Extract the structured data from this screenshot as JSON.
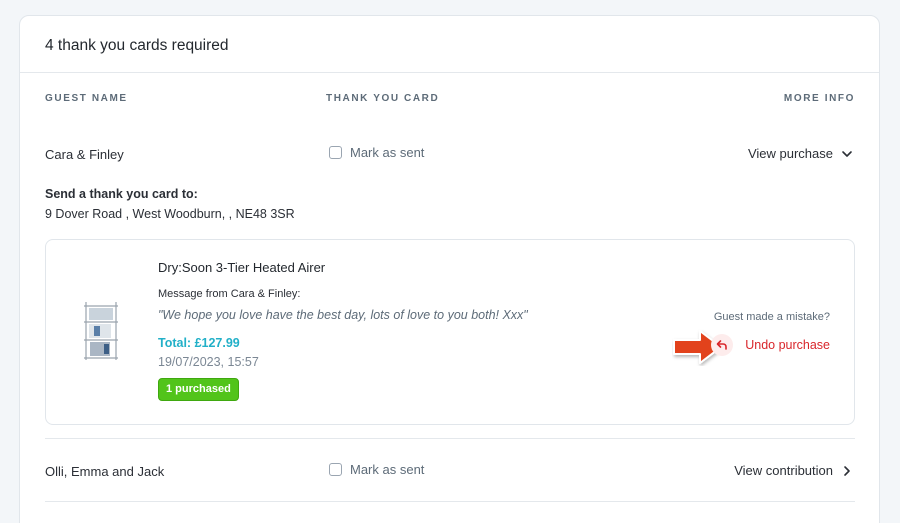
{
  "header": {
    "title": "4 thank you cards required"
  },
  "columns": {
    "guest_name": "GUEST NAME",
    "thank_you_card": "THANK YOU CARD",
    "more_info": "MORE INFO"
  },
  "rows": [
    {
      "guest": "Cara & Finley",
      "mark_label": "Mark as sent",
      "action_label": "View purchase",
      "send_to_label": "Send a thank you card to:",
      "address": "9 Dover Road , West Woodburn, , NE48 3SR",
      "purchase": {
        "product_name": "Dry:Soon 3-Tier Heated Airer",
        "message_label": "Message from Cara & Finley:",
        "message": "\"We hope you love have the best day, lots of love to you both! Xxx\"",
        "total": "Total: £127.99",
        "date": "19/07/2023, 15:57",
        "badge": "1 purchased",
        "mistake_text": "Guest made a mistake?",
        "undo_label": "Undo purchase"
      }
    },
    {
      "guest": "Olli, Emma and Jack",
      "mark_label": "Mark as sent",
      "action_label": "View contribution"
    }
  ],
  "icons": {
    "expand": "chevron-down-icon",
    "navigate": "chevron-right-icon",
    "undo": "undo-arrow-icon",
    "annotation": "red-arrow-icon"
  },
  "colors": {
    "accent_total": "#22b0c8",
    "danger": "#d9262b",
    "badge": "#52c41a",
    "annotation_arrow": "#e2431d"
  }
}
